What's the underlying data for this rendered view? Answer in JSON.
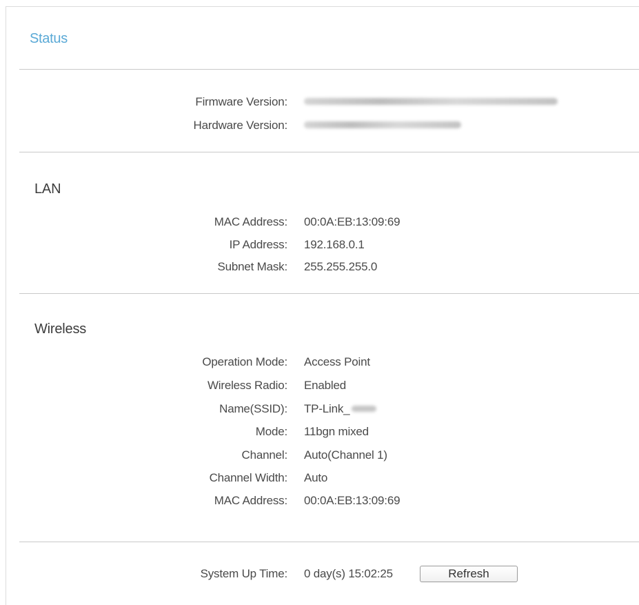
{
  "page": {
    "title": "Status"
  },
  "firmware": {
    "firmware_label": "Firmware Version:",
    "hardware_label": "Hardware Version:"
  },
  "lan": {
    "title": "LAN",
    "rows": [
      {
        "label": "MAC Address:",
        "value": "00:0A:EB:13:09:69"
      },
      {
        "label": "IP Address:",
        "value": "192.168.0.1"
      },
      {
        "label": "Subnet Mask:",
        "value": "255.255.255.0"
      }
    ]
  },
  "wireless": {
    "title": "Wireless",
    "rows": [
      {
        "label": "Operation Mode:",
        "value": "Access Point"
      },
      {
        "label": "Wireless Radio:",
        "value": "Enabled"
      },
      {
        "label": "Name(SSID):",
        "value": "TP-Link_"
      },
      {
        "label": "Mode:",
        "value": "11bgn mixed"
      },
      {
        "label": "Channel:",
        "value": "Auto(Channel 1)"
      },
      {
        "label": "Channel Width:",
        "value": "Auto"
      },
      {
        "label": "MAC Address:",
        "value": "00:0A:EB:13:09:69"
      }
    ]
  },
  "system": {
    "uptime_label": "System Up Time:",
    "uptime_value": "0 day(s) 15:02:25",
    "refresh_label": "Refresh"
  },
  "colors": {
    "title_accent": "#5aa9d6",
    "divider": "#c9c9c9"
  }
}
